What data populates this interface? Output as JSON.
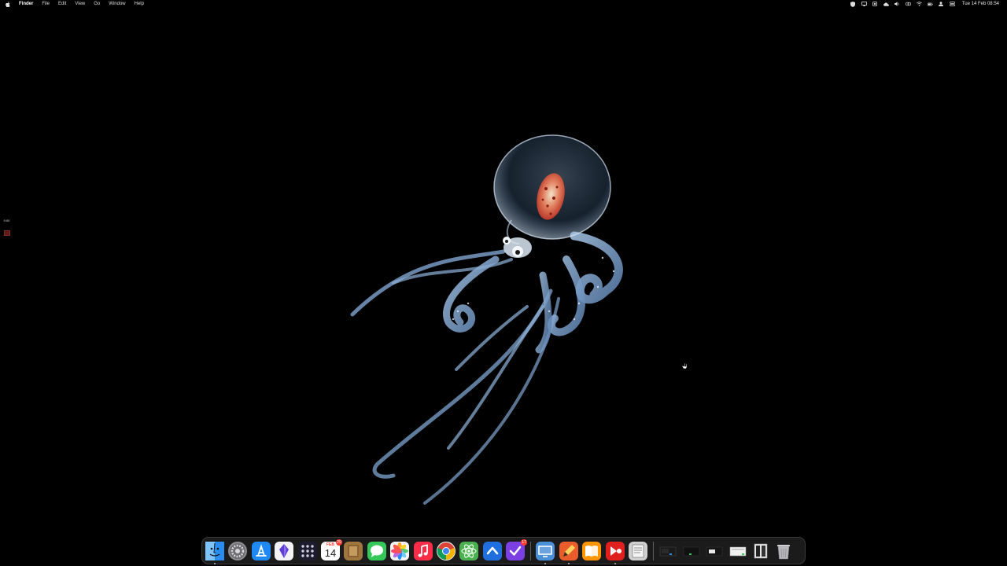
{
  "menubar": {
    "app_name": "Finder",
    "menus": [
      "File",
      "Edit",
      "View",
      "Go",
      "Window",
      "Help"
    ],
    "clock": "Tue 14 Feb  08:54",
    "status_icons": [
      "shield-icon",
      "cast-icon",
      "app-status-icon",
      "cloud-icon",
      "volume-icon",
      "creative-cloud-icon",
      "wifi-icon",
      "battery-icon",
      "user-icon",
      "control-center-icon"
    ]
  },
  "recording_widget": {
    "time": "0:00"
  },
  "dock": {
    "apps": [
      {
        "name": "Finder",
        "icon": "finder-icon",
        "color": "#2b8cf0"
      },
      {
        "name": "System Preferences",
        "icon": "gear-icon",
        "color": "#8e8e93"
      },
      {
        "name": "App Store",
        "icon": "app-store-icon",
        "color": "#1e88f5"
      },
      {
        "name": "Notion",
        "icon": "gem-icon",
        "color": "#f2f2f7"
      },
      {
        "name": "Launchpad",
        "icon": "launchpad-icon",
        "color": "#1c1c2e"
      },
      {
        "name": "Calendar",
        "icon": "calendar-icon",
        "month": "FEB",
        "day": "14",
        "badge": "29"
      },
      {
        "name": "Notes App",
        "icon": "notebook-icon",
        "color": "#a0763f"
      },
      {
        "name": "Messages",
        "icon": "messages-icon",
        "color": "#34c759"
      },
      {
        "name": "Photos",
        "icon": "photos-icon",
        "color": "#f5f5f5"
      },
      {
        "name": "Music",
        "icon": "music-icon",
        "color": "#fa2d48"
      },
      {
        "name": "Chrome",
        "icon": "chrome-icon",
        "color": "#ffffff"
      },
      {
        "name": "Atom",
        "icon": "atom-icon",
        "color": "#4caf50"
      },
      {
        "name": "Prompt",
        "icon": "chevron-up-icon",
        "color": "#1f6fe0"
      },
      {
        "name": "Tasks",
        "icon": "checkmark-icon",
        "color": "#7b3fe4",
        "badge": "17"
      }
    ],
    "running": [
      {
        "name": "Preview",
        "icon": "monitor-icon",
        "color": "#4a90d9"
      },
      {
        "name": "Pencil",
        "icon": "pencil-icon",
        "color": "#e85d2a"
      },
      {
        "name": "Books",
        "icon": "book-icon",
        "color": "#ff9500"
      },
      {
        "name": "Screen Recorder",
        "icon": "record-icon",
        "color": "#e0201f"
      },
      {
        "name": "Script",
        "icon": "scroll-icon",
        "color": "#d0d0d0"
      }
    ],
    "windows": [
      {
        "name": "Window 1",
        "icon": "window-thumbnail-icon"
      },
      {
        "name": "Window 2",
        "icon": "window-thumbnail-icon"
      },
      {
        "name": "Window 3",
        "icon": "window-thumbnail-icon"
      },
      {
        "name": "Window 4",
        "icon": "window-thumbnail-icon"
      },
      {
        "name": "Window 5",
        "icon": "window-thumbnail-icon"
      },
      {
        "name": "Trash",
        "icon": "trash-icon"
      }
    ]
  }
}
